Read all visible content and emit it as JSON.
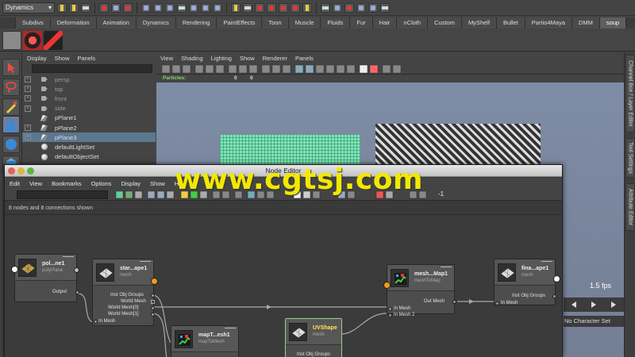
{
  "status_line": {
    "mode": "Dynamics"
  },
  "shelf": {
    "tabs": [
      "Subdivs",
      "Deformation",
      "Animation",
      "Dynamics",
      "Rendering",
      "PaintEffects",
      "Toon",
      "Muscle",
      "Fluids",
      "Fur",
      "Hair",
      "nCloth",
      "Custom",
      "MyShelf",
      "Bullet",
      "Partio4Maya",
      "DMM",
      "soup"
    ],
    "active_tab": "soup"
  },
  "outliner": {
    "menu": [
      "Display",
      "Show",
      "Panels"
    ],
    "items": [
      {
        "label": "persp",
        "icon": "camera-icon",
        "dim": true,
        "expand": true
      },
      {
        "label": "top",
        "icon": "camera-icon",
        "dim": true,
        "expand": true
      },
      {
        "label": "front",
        "icon": "camera-icon",
        "dim": true,
        "expand": true
      },
      {
        "label": "side",
        "icon": "camera-icon",
        "dim": true,
        "expand": true
      },
      {
        "label": "pPlane1",
        "icon": "mesh-icon",
        "dim": false,
        "expand": false
      },
      {
        "label": "pPlane2",
        "icon": "mesh-icon",
        "dim": false,
        "expand": true
      },
      {
        "label": "pPlane3",
        "icon": "mesh-icon",
        "dim": false,
        "expand": true,
        "selected": true
      },
      {
        "label": "defaultLightSet",
        "icon": "set-icon",
        "dim": false,
        "expand": false
      },
      {
        "label": "defaultObjectSet",
        "icon": "set-icon",
        "dim": false,
        "expand": false
      }
    ]
  },
  "viewport": {
    "menu": [
      "View",
      "Shading",
      "Lighting",
      "Show",
      "Renderer",
      "Panels"
    ],
    "hud_label": "Particles:",
    "hud_values": [
      "0",
      "0"
    ],
    "fps": "1.5 fps"
  },
  "side_tabs": {
    "channel_box": "Channel Box / Layer Editor",
    "tool_settings": "Tool Settings",
    "attribute_editor": "Attribute Editor"
  },
  "character_set": "No Character Set",
  "node_editor": {
    "title": "Node Editor",
    "menu": [
      "Edit",
      "View",
      "Bookmarks",
      "Options",
      "Display",
      "Show",
      "Help"
    ],
    "status": "8 nodes and 8 connections shown",
    "toolbar_value": "-1",
    "nodes": {
      "poly": {
        "title": "pol...ne1",
        "type": "polyPlane",
        "attrs": [
          "Output"
        ]
      },
      "start": {
        "title": "star...ape1",
        "type": "mesh",
        "attrs": [
          "Inst Obj Groups",
          "World Mesh",
          "World Mesh[0]",
          "World Mesh[1]",
          "In Mesh"
        ]
      },
      "map": {
        "title": "mapT...esh1",
        "type": "mapToMesh"
      },
      "uv": {
        "title": "UVShape",
        "type": "mesh",
        "attrs": [
          "Inst Obj Groups"
        ]
      },
      "mtm": {
        "title": "mesh...Map1",
        "type": "meshToMap",
        "attrs": [
          "Out Mesh",
          "In Mesh",
          "In Mesh 2"
        ]
      },
      "final": {
        "title": "fina...ape1",
        "type": "mesh",
        "attrs": [
          "Inst Obj Groups",
          "In Mesh"
        ]
      }
    }
  },
  "watermark": "www.cgtsj.com"
}
